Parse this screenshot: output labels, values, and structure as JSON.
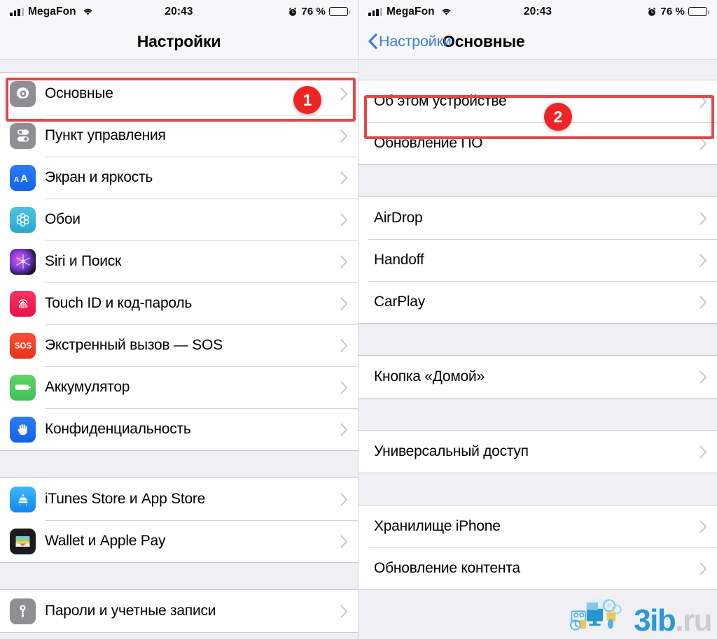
{
  "colors": {
    "accent_blue": "#3b7fd4",
    "highlight_red": "#e04a4a",
    "badge_red": "#ef2525",
    "group_bg": "#efeff4",
    "watermark_blue": "#2196d6",
    "watermark_gray": "#c9cbcd"
  },
  "status_bar": {
    "carrier": "MegaFon",
    "time": "20:43",
    "battery_percent": "76 %",
    "signal_icon": "signal-bars-icon",
    "wifi_icon": "wifi-icon",
    "alarm_icon": "alarm-clock-icon",
    "battery_icon": "battery-icon"
  },
  "left_screen": {
    "nav": {
      "title": "Настройки"
    },
    "groups": [
      {
        "items": [
          {
            "label": "Основные",
            "icon": "gear-icon",
            "chevron": "chevron-right-icon"
          },
          {
            "label": "Пункт управления",
            "icon": "control-center-icon",
            "chevron": "chevron-right-icon"
          },
          {
            "label": "Экран и яркость",
            "icon": "display-brightness-icon",
            "chevron": "chevron-right-icon"
          },
          {
            "label": "Обои",
            "icon": "wallpaper-icon",
            "chevron": "chevron-right-icon"
          },
          {
            "label": "Siri и Поиск",
            "icon": "siri-icon",
            "chevron": "chevron-right-icon"
          },
          {
            "label": "Touch ID и код-пароль",
            "icon": "touch-id-icon",
            "chevron": "chevron-right-icon"
          },
          {
            "label": "Экстренный вызов — SOS",
            "icon": "sos-icon",
            "chevron": "chevron-right-icon"
          },
          {
            "label": "Аккумулятор",
            "icon": "battery-settings-icon",
            "chevron": "chevron-right-icon"
          },
          {
            "label": "Конфиденциальность",
            "icon": "privacy-hand-icon",
            "chevron": "chevron-right-icon"
          }
        ]
      },
      {
        "items": [
          {
            "label": "iTunes Store и App Store",
            "icon": "app-store-icon",
            "chevron": "chevron-right-icon"
          },
          {
            "label": "Wallet и Apple Pay",
            "icon": "wallet-icon",
            "chevron": "chevron-right-icon"
          }
        ]
      },
      {
        "items": [
          {
            "label": "Пароли и учетные записи",
            "icon": "key-icon",
            "chevron": "chevron-right-icon"
          }
        ]
      }
    ],
    "highlight": {
      "badge": "1",
      "target_label": "Основные"
    }
  },
  "right_screen": {
    "nav": {
      "back_label": "Настройки",
      "title": "Основные",
      "back_icon": "chevron-left-icon"
    },
    "groups": [
      {
        "items": [
          {
            "label": "Об этом устройстве",
            "chevron": "chevron-right-icon"
          },
          {
            "label": "Обновление ПО",
            "chevron": "chevron-right-icon"
          }
        ]
      },
      {
        "items": [
          {
            "label": "AirDrop",
            "chevron": "chevron-right-icon"
          },
          {
            "label": "Handoff",
            "chevron": "chevron-right-icon"
          },
          {
            "label": "CarPlay",
            "chevron": "chevron-right-icon"
          }
        ]
      },
      {
        "items": [
          {
            "label": "Кнопка «Домой»",
            "chevron": "chevron-right-icon"
          }
        ]
      },
      {
        "items": [
          {
            "label": "Универсальный доступ",
            "chevron": "chevron-right-icon"
          }
        ]
      },
      {
        "items": [
          {
            "label": "Хранилище iPhone",
            "chevron": "chevron-right-icon"
          },
          {
            "label": "Обновление контента",
            "chevron": "chevron-right-icon"
          }
        ]
      }
    ],
    "highlight": {
      "badge": "2",
      "target_label": "Об этом устройстве"
    }
  },
  "watermark": {
    "primary": "3ib",
    "suffix": ".ru",
    "logo_icon": "devices-cluster-icon"
  }
}
